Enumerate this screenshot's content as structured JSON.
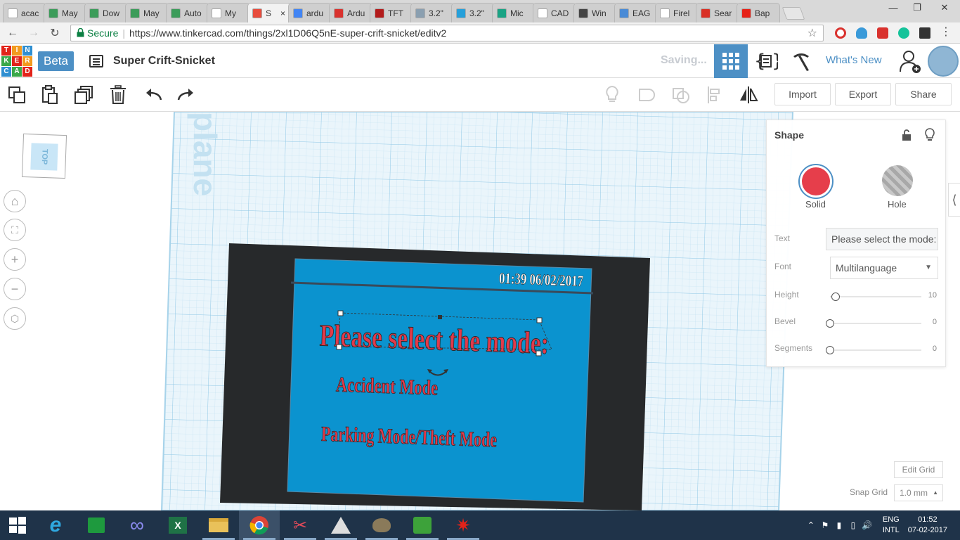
{
  "browser": {
    "tabs": [
      {
        "title": "acac",
        "fav": "#ffffff",
        "active": false
      },
      {
        "title": "May",
        "fav": "#3c9c5a",
        "active": false
      },
      {
        "title": "Dow",
        "fav": "#3c9c5a",
        "active": false
      },
      {
        "title": "May",
        "fav": "#3c9c5a",
        "active": false
      },
      {
        "title": "Auto",
        "fav": "#3c9c5a",
        "active": false
      },
      {
        "title": "My",
        "fav": "#ffffff",
        "active": false
      },
      {
        "title": "S",
        "fav": "#e84c3d",
        "active": true
      },
      {
        "title": "ardu",
        "fav": "#4285f4",
        "active": false
      },
      {
        "title": "Ardu",
        "fav": "#d9322e",
        "active": false
      },
      {
        "title": "TFT",
        "fav": "#b31b1b",
        "active": false
      },
      {
        "title": "3.2\"",
        "fav": "#8a9fb0",
        "active": false
      },
      {
        "title": "3.2\"",
        "fav": "#26a0da",
        "active": false
      },
      {
        "title": "Mic",
        "fav": "#1aa384",
        "active": false
      },
      {
        "title": "CAD",
        "fav": "#ffffff",
        "active": false
      },
      {
        "title": "Win",
        "fav": "#444444",
        "active": false
      },
      {
        "title": "EAG",
        "fav": "#4a8bd6",
        "active": false
      },
      {
        "title": "Firel",
        "fav": "#ffffff",
        "active": false
      },
      {
        "title": "Sear",
        "fav": "#d93025",
        "active": false
      },
      {
        "title": "Bap",
        "fav": "#e62117",
        "active": false
      }
    ],
    "secure_label": "Secure",
    "url": "https://www.tinkercad.com/things/2xl1D06Q5nE-super-crift-snicket/editv2"
  },
  "app": {
    "logo_letters": [
      "TIN",
      "KER",
      "CAD"
    ],
    "beta_label": "Beta",
    "design_name": "Super Crift-Snicket",
    "saving_label": "Saving...",
    "whats_new": "What's New"
  },
  "toolbar": {
    "import_label": "Import",
    "export_label": "Export",
    "share_label": "Share"
  },
  "workplane": {
    "viewcube_face": "TOP",
    "watermark": "plane"
  },
  "design": {
    "datetime": "01:39 06/02/2017",
    "line1": "Please select the mode:",
    "line2": "Accident Mode",
    "line3": "Parking Mode/Theft Mode",
    "colors": {
      "frame": "#27292b",
      "screen": "#0b93cf",
      "text": "#e23a4b"
    }
  },
  "shape_panel": {
    "title": "Shape",
    "solid_label": "Solid",
    "hole_label": "Hole",
    "text_label": "Text",
    "text_value": "Please select the mode:",
    "font_label": "Font",
    "font_value": "Multilanguage",
    "height_label": "Height",
    "height_value": "10",
    "bevel_label": "Bevel",
    "bevel_value": "0",
    "segments_label": "Segments",
    "segments_value": "0"
  },
  "grid": {
    "edit_label": "Edit Grid",
    "snap_label": "Snap Grid",
    "snap_value": "1.0 mm"
  },
  "taskbar": {
    "lang": "ENG",
    "lang2": "INTL",
    "time": "01:52",
    "date": "07-02-2017"
  }
}
